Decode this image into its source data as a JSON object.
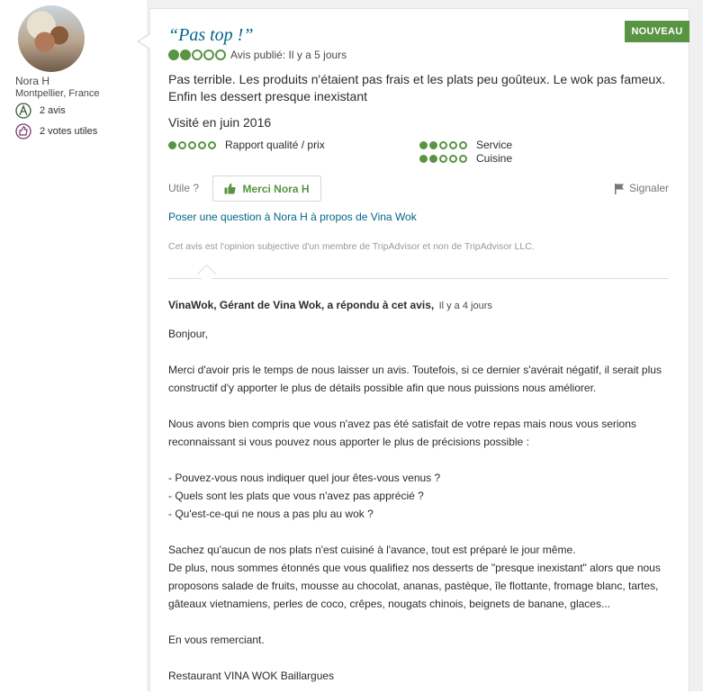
{
  "reviewer": {
    "name": "Nora H",
    "location": "Montpellier, France",
    "reviews_count": "2 avis",
    "helpful_votes": "2 votes utiles"
  },
  "review": {
    "badge": "NOUVEAU",
    "title": "“Pas top !”",
    "rating": 2,
    "rating_max": 5,
    "published": "Avis publié: Il y a 5 jours",
    "body": "Pas terrible. Les produits n'étaient pas frais et les plats peu goûteux. Le wok pas fameux. Enfin les dessert presque inexistant",
    "visited": "Visité en juin 2016",
    "sub_ratings": [
      {
        "label": "Rapport qualité / prix",
        "rating": 1
      },
      {
        "label": "Service",
        "rating": 2
      },
      {
        "label": "Cuisine",
        "rating": 2
      }
    ]
  },
  "actions": {
    "utile_label": "Utile ?",
    "thanks_button": "Merci Nora H",
    "report": "Signaler",
    "ask_question": "Poser une question à Nora H à propos de Vina Wok"
  },
  "disclaimer": "Cet avis est l'opinion subjective d'un membre de TripAdvisor et non de TripAdvisor LLC.",
  "response": {
    "author": "VinaWok, Gérant de Vina Wok, a répondu à cet avis,",
    "date": "Il y a 4 jours",
    "paragraphs": [
      [
        "Bonjour,"
      ],
      [
        "Merci d'avoir pris le temps de nous laisser un avis. Toutefois, si ce dernier s'avérait négatif, il serait plus",
        "constructif d'y apporter le plus de détails possible afin que nous puissions nous améliorer."
      ],
      [
        "Nous avons bien compris que vous n'avez pas été satisfait de votre repas mais nous vous serions",
        "reconnaissant si vous pouvez nous apporter le plus de précisions possible :"
      ],
      [
        "- Pouvez-vous nous indiquer quel jour êtes-vous venus ?",
        "- Quels sont les plats que vous n'avez pas apprécié ?",
        "- Qu'est-ce-qui ne nous a pas plu au wok ?"
      ],
      [
        "Sachez qu'aucun de nos plats n'est cuisiné à l'avance, tout est préparé le jour même.",
        "De plus, nous sommes étonnés que vous qualifiez nos desserts de \"presque inexistant\" alors que nous",
        "proposons salade de fruits, mousse au chocolat, ananas, pastèque, île flottante, fromage blanc, tartes,",
        "gâteaux vietnamiens, perles de coco, crêpes, nougats chinois, beignets de banane, glaces..."
      ],
      [
        "En vous remerciant."
      ],
      [
        "Restaurant VINA WOK Baillargues"
      ]
    ]
  },
  "colors": {
    "accent_green": "#589442",
    "link_blue": "#00658a"
  }
}
